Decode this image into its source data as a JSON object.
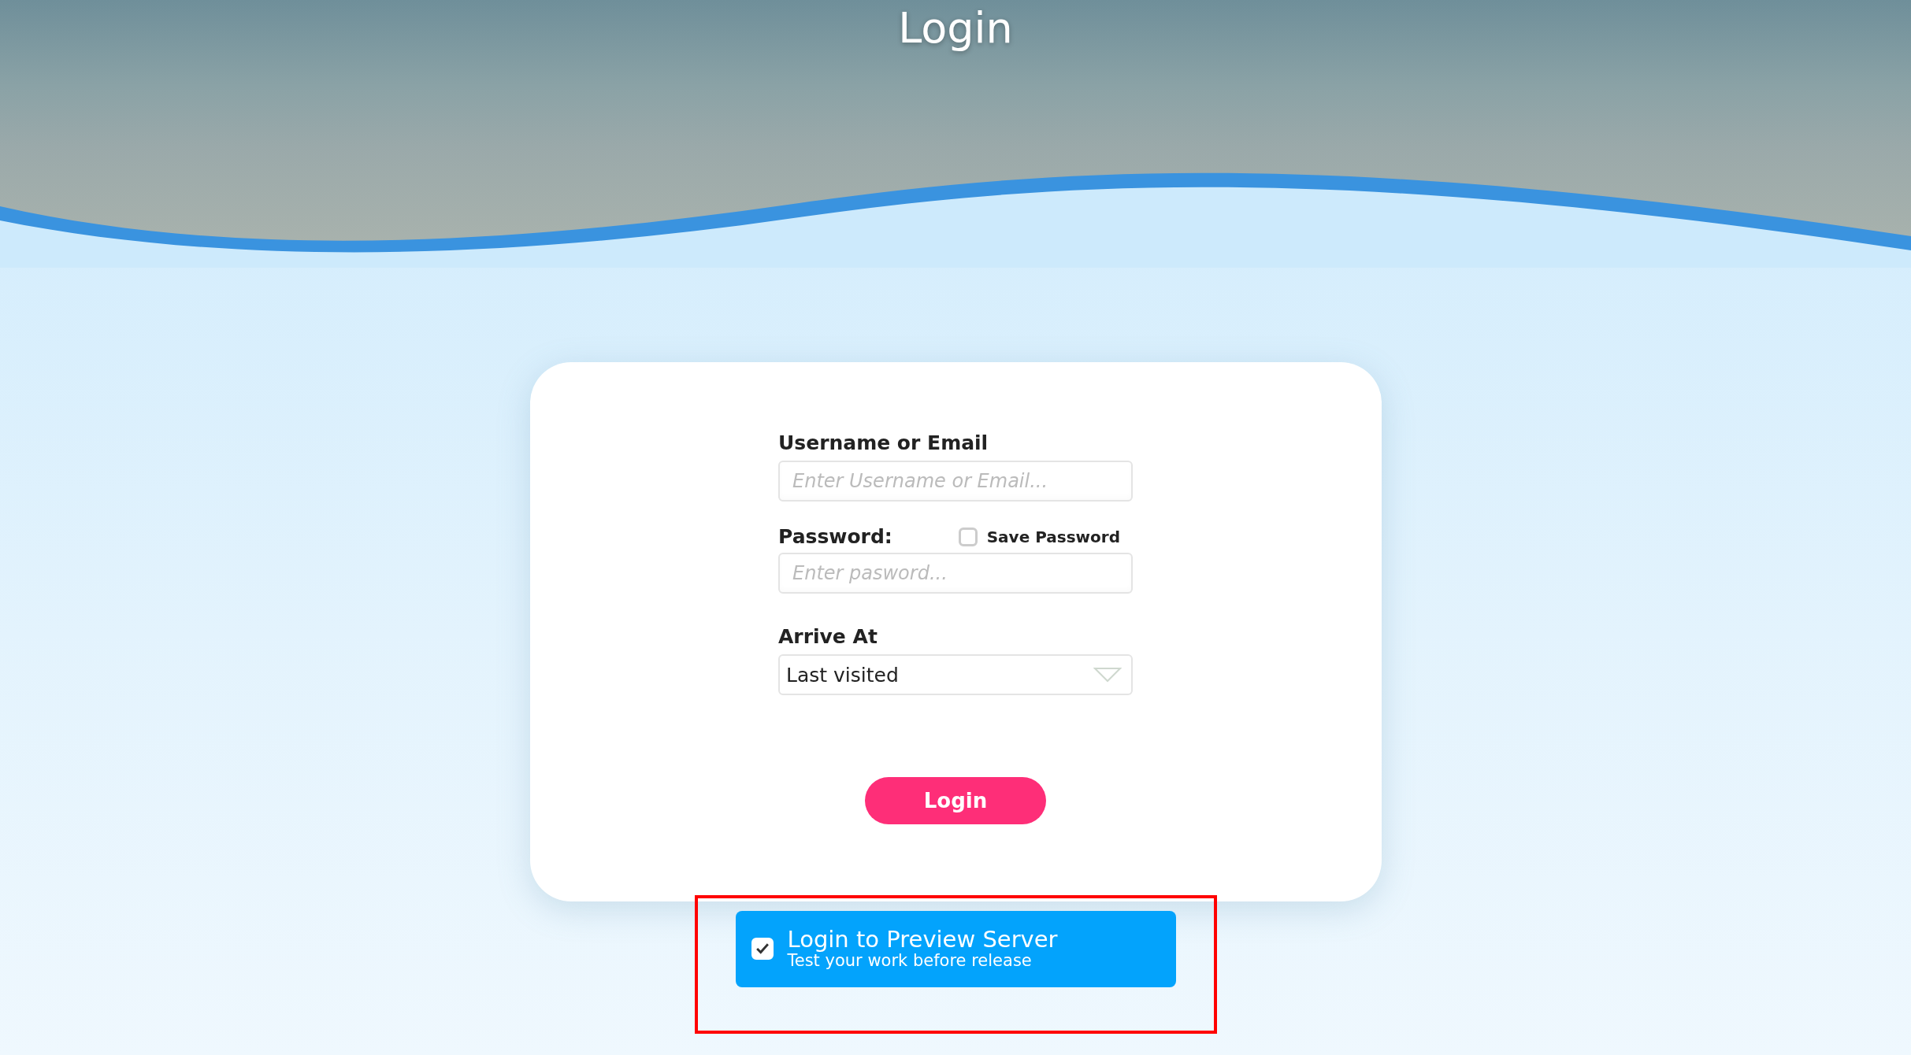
{
  "page": {
    "title": "Login"
  },
  "form": {
    "username": {
      "label": "Username or Email",
      "placeholder": "Enter Username or Email..."
    },
    "password": {
      "label": "Password:",
      "placeholder": "Enter pasword...",
      "save_password": {
        "label": "Save Password",
        "checked": false
      }
    },
    "arrive_at": {
      "label": "Arrive At",
      "value": "Last visited"
    },
    "submit": "Login"
  },
  "preview_server": {
    "title": "Login to Preview Server",
    "subtitle": "Test your work before release",
    "checked": true
  }
}
